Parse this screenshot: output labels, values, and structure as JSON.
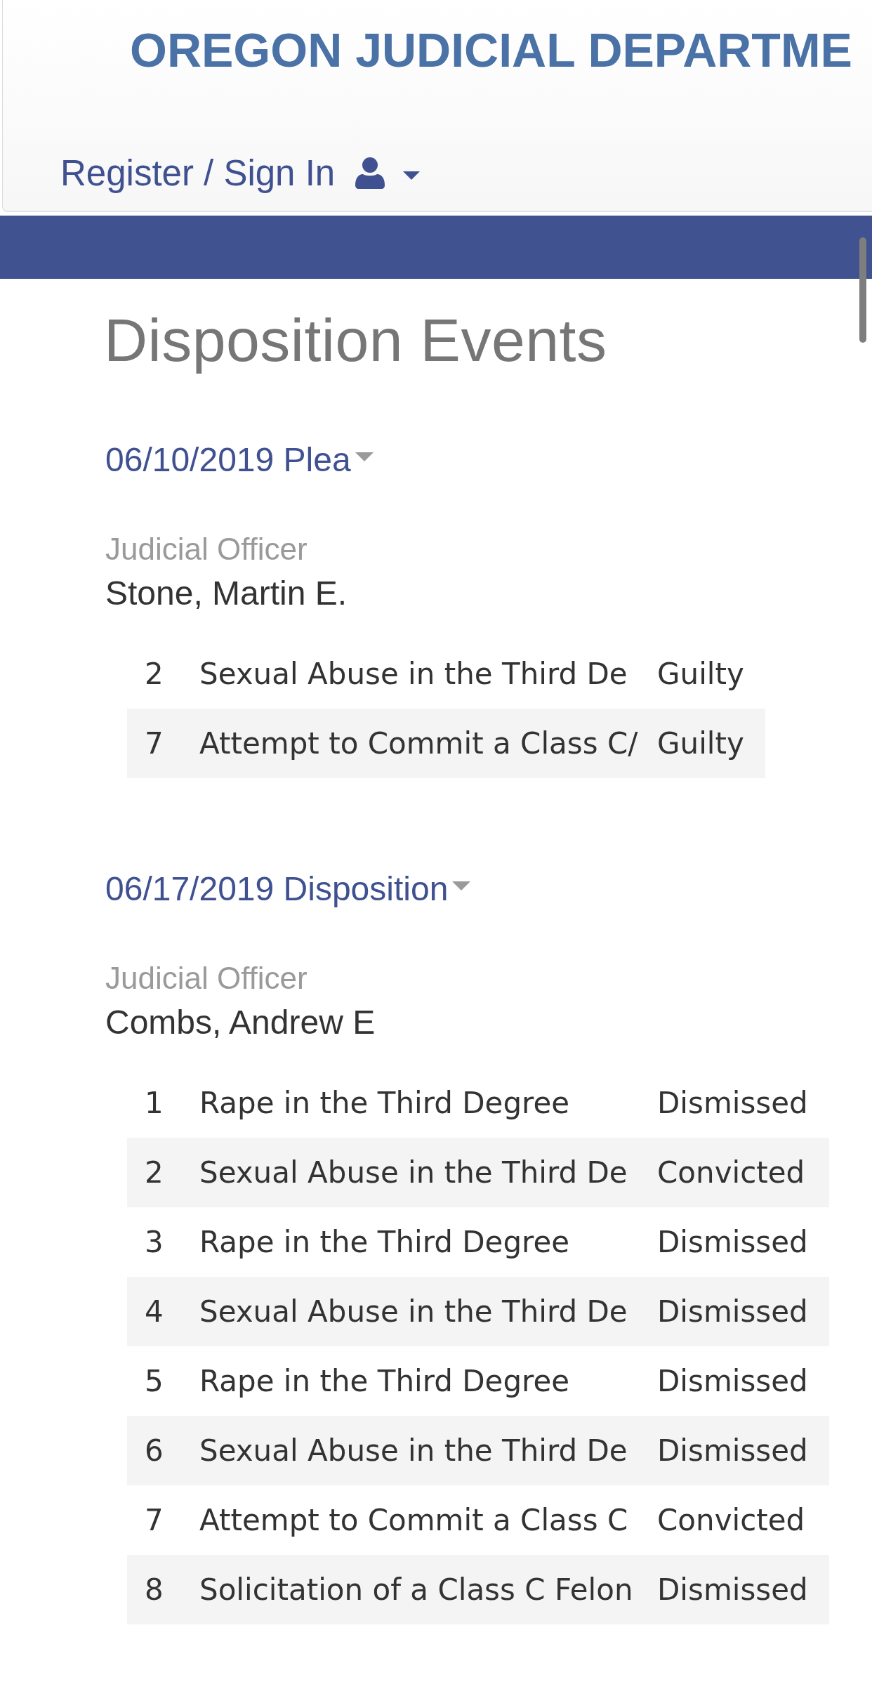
{
  "header": {
    "title": "OREGON JUDICIAL DEPARTME",
    "account_link": "Register / Sign In"
  },
  "page_title": "Disposition Events",
  "events": [
    {
      "heading": "06/10/2019 Plea",
      "officer_label": "Judicial Officer",
      "officer": "Stone, Martin E.",
      "charges": [
        {
          "number": "2",
          "description": "Sexual Abuse in the Third De",
          "outcome": "Guilty"
        },
        {
          "number": "7",
          "description": "Attempt to Commit a Class C/",
          "outcome": "Guilty"
        }
      ]
    },
    {
      "heading": "06/17/2019 Disposition",
      "officer_label": "Judicial Officer",
      "officer": "Combs, Andrew E",
      "charges": [
        {
          "number": "1",
          "description": "Rape in the Third Degree",
          "outcome": "Dismissed"
        },
        {
          "number": "2",
          "description": "Sexual Abuse in the Third De",
          "outcome": "Convicted"
        },
        {
          "number": "3",
          "description": "Rape in the Third Degree",
          "outcome": "Dismissed"
        },
        {
          "number": "4",
          "description": "Sexual Abuse in the Third De",
          "outcome": "Dismissed"
        },
        {
          "number": "5",
          "description": "Rape in the Third Degree",
          "outcome": "Dismissed"
        },
        {
          "number": "6",
          "description": "Sexual Abuse in the Third De",
          "outcome": "Dismissed"
        },
        {
          "number": "7",
          "description": "Attempt to Commit a Class C",
          "outcome": "Convicted"
        },
        {
          "number": "8",
          "description": "Solicitation of a Class C Felon",
          "outcome": "Dismissed"
        }
      ]
    }
  ]
}
